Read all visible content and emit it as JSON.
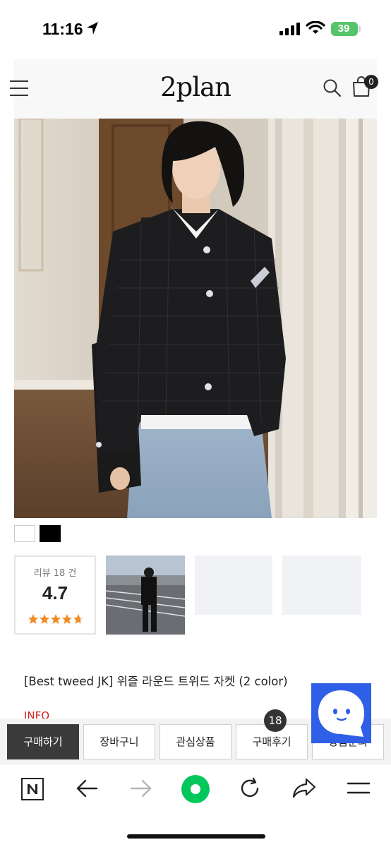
{
  "status_bar": {
    "time": "11:16",
    "battery": "39",
    "icons": [
      "location-arrow-icon",
      "signal-bars-icon",
      "wifi-icon",
      "battery-icon"
    ]
  },
  "header": {
    "logo": "2plan",
    "cart_count": "0",
    "icons": [
      "hamburger-menu-icon",
      "search-icon",
      "shopping-bag-icon"
    ]
  },
  "product": {
    "swatches": [
      {
        "name": "white",
        "color": "#ffffff"
      },
      {
        "name": "black",
        "color": "#000000"
      }
    ],
    "review": {
      "label": "리뷰 18 건",
      "score": "4.7",
      "stars": 4.7,
      "star_color": "#f08a24"
    },
    "title": "[Best tweed JK] 위즐 라운드 트위드 자켓 (2 color)",
    "info_label": "INFO"
  },
  "action_bar": {
    "buttons": [
      "구매하기",
      "장바구니",
      "관심상품",
      "구매후기",
      "상품문의"
    ],
    "review_badge": "18"
  },
  "browser_toolbar": {
    "icons": [
      "naver-n-icon",
      "back-arrow-icon",
      "forward-arrow-icon",
      "green-home-icon",
      "reload-icon",
      "share-icon",
      "menu-icon"
    ]
  },
  "colors": {
    "accent_red": "#d2231f",
    "chat_blue": "#2f5fe6",
    "battery_green": "#56c46a",
    "naver_green": "#03c75a"
  }
}
